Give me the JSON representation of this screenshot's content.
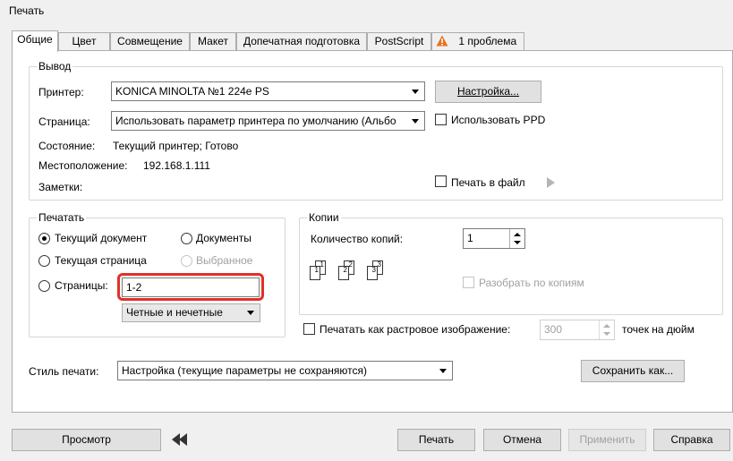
{
  "window": {
    "title": "Печать"
  },
  "tabs": [
    {
      "label": "Общие"
    },
    {
      "label": "Цвет"
    },
    {
      "label": "Совмещение"
    },
    {
      "label": "Макет"
    },
    {
      "label": "Допечатная подготовка"
    },
    {
      "label": "PostScript"
    },
    {
      "label": "1 проблема",
      "icon": "warning-icon",
      "icon_color": "#e8731e"
    }
  ],
  "output": {
    "legend": "Вывод",
    "printer_label": "Принтер:",
    "printer_value": "KONICA MINOLTA №1 224e PS",
    "setup_button": "Настройка...",
    "page_label": "Страница:",
    "page_value": "Использовать параметр принтера по умолчанию (Альбо",
    "use_ppd": "Использовать PPD",
    "status_label": "Состояние:",
    "status_value": "Текущий принтер; Готово",
    "location_label": "Местоположение:",
    "location_value": "192.168.1.111",
    "notes_label": "Заметки:",
    "print_to_file": "Печать в файл"
  },
  "print_range": {
    "legend": "Печатать",
    "current_document": "Текущий документ",
    "documents": "Документы",
    "current_page": "Текущая страница",
    "selection": "Выбранное",
    "pages": "Страницы:",
    "pages_value": "1-2",
    "parity_value": "Четные и нечетные",
    "highlight_color": "#e0302a"
  },
  "copies": {
    "legend": "Копии",
    "count_label": "Количество копий:",
    "count_value": "1",
    "collate": "Разобрать по копиям",
    "icon_pages": [
      "1",
      "2",
      "3"
    ]
  },
  "raster": {
    "label": "Печатать как растровое изображение:",
    "dpi_value": "300",
    "dpi_unit": "точек на дюйм"
  },
  "style": {
    "label": "Стиль печати:",
    "value": "Настройка (текущие параметры не сохраняются)",
    "save_as": "Сохранить как..."
  },
  "footer": {
    "preview": "Просмотр",
    "print": "Печать",
    "cancel": "Отмена",
    "apply": "Применить",
    "help": "Справка"
  }
}
